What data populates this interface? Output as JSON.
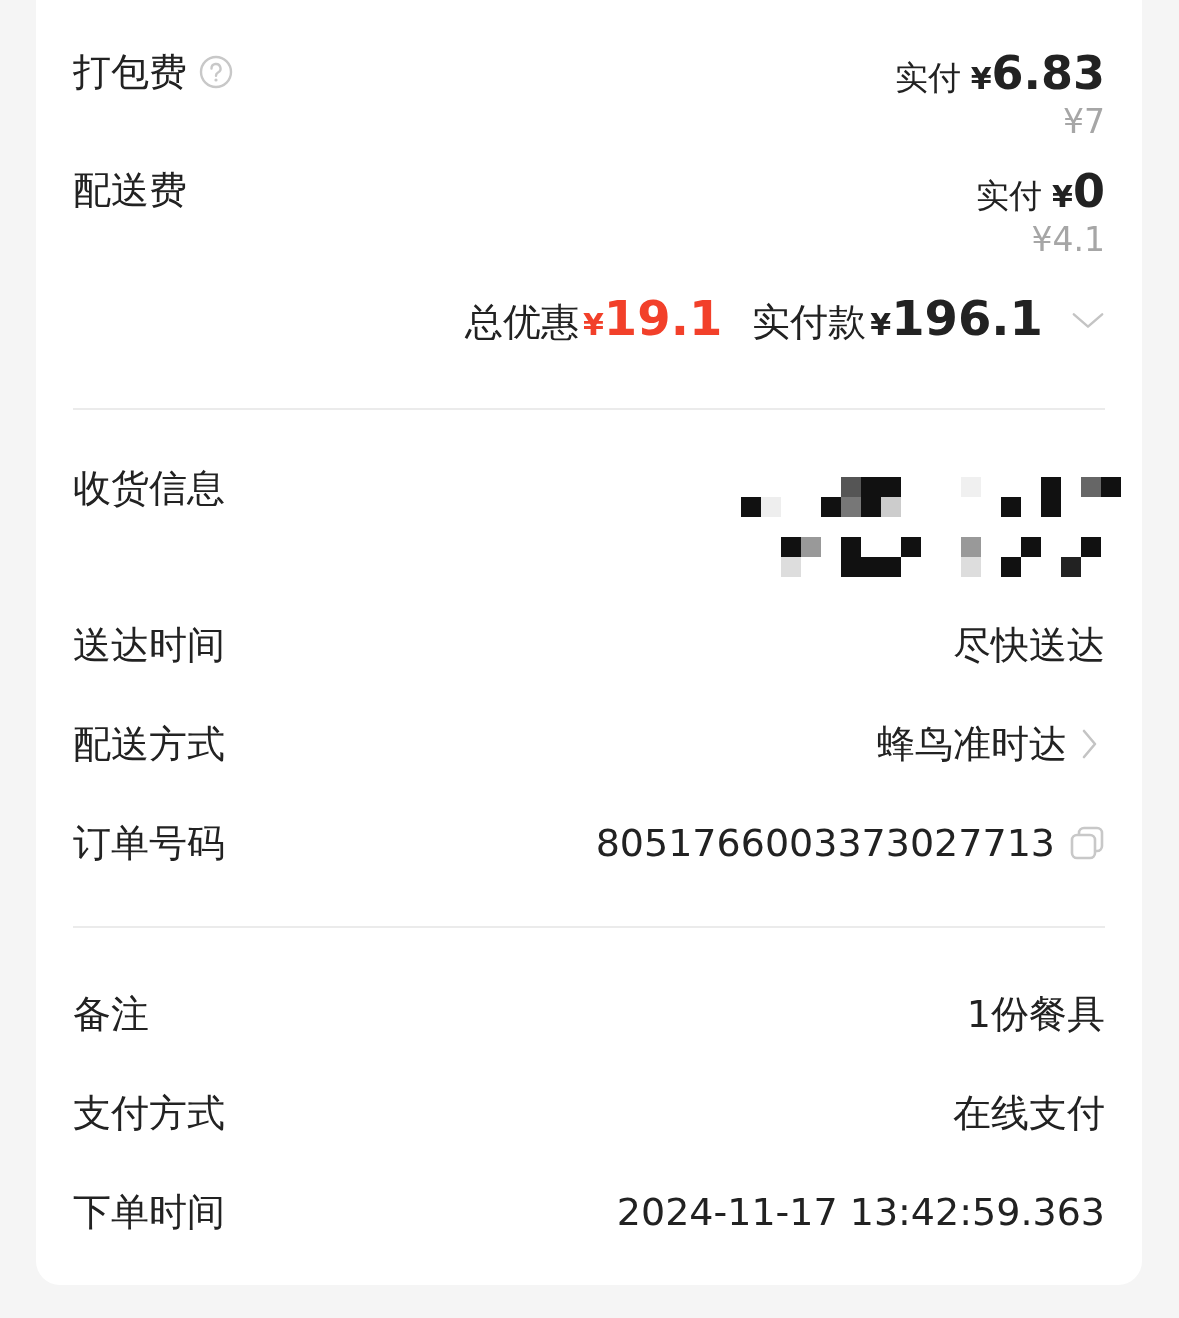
{
  "fees": [
    {
      "label": "打包费",
      "help": true,
      "paid_label": "实付",
      "currency": "¥",
      "paid_amount": "6.83",
      "original": "¥7"
    },
    {
      "label": "配送费",
      "help": false,
      "paid_label": "实付",
      "currency": "¥",
      "paid_amount": "0",
      "original": "¥4.1"
    }
  ],
  "summary": {
    "discount_label": "总优惠",
    "discount_currency": "¥",
    "discount_amount": "19.1",
    "total_label": "实付款",
    "total_currency": "¥",
    "total_amount": "196.1",
    "expanded": false
  },
  "details": [
    {
      "kind": "redacted",
      "label": "收货信息"
    },
    {
      "kind": "text",
      "label": "送达时间",
      "value": "尽快送达"
    },
    {
      "kind": "link",
      "label": "配送方式",
      "value": "蜂鸟准时达"
    },
    {
      "kind": "copy",
      "label": "订单号码",
      "value": "8051766003373027713"
    }
  ],
  "extras": [
    {
      "kind": "text",
      "label": "备注",
      "value": "1份餐具"
    },
    {
      "kind": "text",
      "label": "支付方式",
      "value": "在线支付"
    },
    {
      "kind": "text",
      "label": "下单时间",
      "value": "2024-11-17 13:42:59.363"
    }
  ]
}
